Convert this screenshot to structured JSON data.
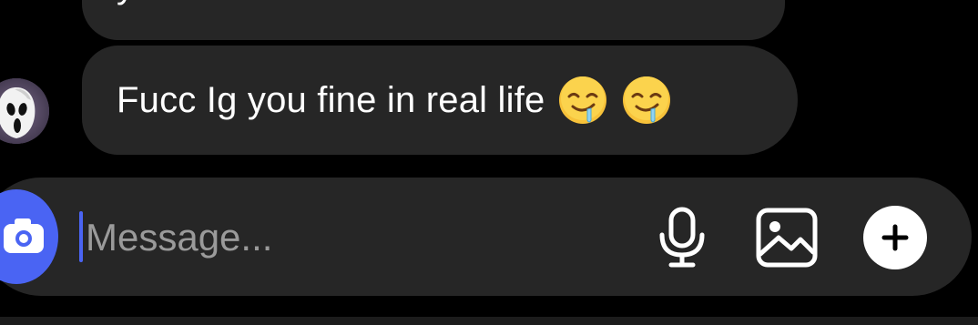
{
  "conversation": {
    "messages": [
      {
        "id": "previous",
        "text": "y",
        "sender": "other"
      },
      {
        "id": "latest",
        "text": "Fucc Ig you fine in real life",
        "emojis": [
          "drooling-face",
          "drooling-face"
        ],
        "sender": "other"
      }
    ]
  },
  "composer": {
    "placeholder": "Message...",
    "value": "",
    "icons": {
      "camera": "camera-icon",
      "mic": "microphone-icon",
      "gallery": "gallery-icon",
      "add": "plus-icon"
    }
  },
  "colors": {
    "background": "#000000",
    "bubble": "#262626",
    "accent": "#4a64f3",
    "placeholder": "#9a9a9a",
    "text": "#ffffff"
  }
}
